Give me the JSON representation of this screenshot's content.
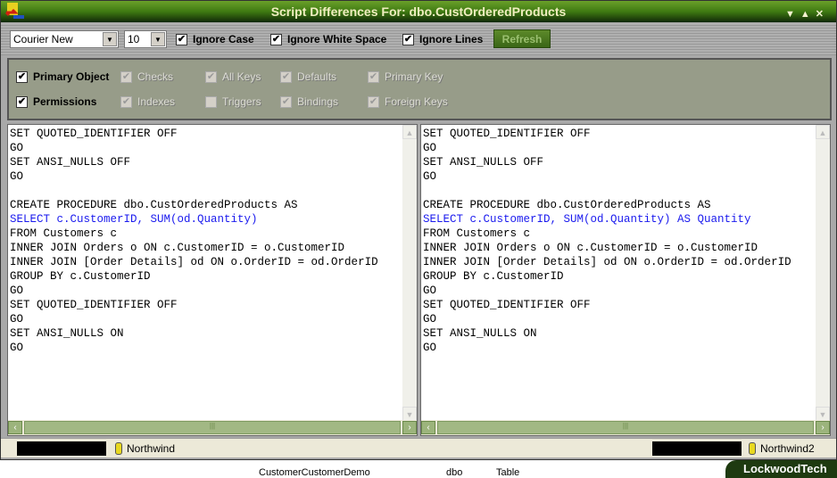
{
  "title": "Script Differences For:  dbo.CustOrderedProducts",
  "toolbar": {
    "font": "Courier New",
    "size": "10",
    "ignore_case": "Ignore Case",
    "ignore_ws": "Ignore White Space",
    "ignore_lines": "Ignore Lines",
    "refresh": "Refresh"
  },
  "options": {
    "primary_object": "Primary Object",
    "permissions": "Permissions",
    "checks": "Checks",
    "indexes": "Indexes",
    "all_keys": "All Keys",
    "triggers": "Triggers",
    "defaults": "Defaults",
    "bindings": "Bindings",
    "primary_key": "Primary Key",
    "foreign_keys": "Foreign Keys"
  },
  "left_code": [
    "SET QUOTED_IDENTIFIER OFF",
    "GO",
    "SET ANSI_NULLS OFF",
    "GO",
    "",
    "CREATE PROCEDURE dbo.CustOrderedProducts AS",
    "SELECT c.CustomerID, SUM(od.Quantity)",
    "FROM Customers c",
    "INNER JOIN Orders o ON c.CustomerID = o.CustomerID",
    "INNER JOIN [Order Details] od ON o.OrderID = od.OrderID",
    "GROUP BY c.CustomerID",
    "GO",
    "SET QUOTED_IDENTIFIER OFF",
    "GO",
    "SET ANSI_NULLS ON",
    "GO"
  ],
  "right_code": [
    "SET QUOTED_IDENTIFIER OFF",
    "GO",
    "SET ANSI_NULLS OFF",
    "GO",
    "",
    "CREATE PROCEDURE dbo.CustOrderedProducts AS",
    "SELECT c.CustomerID, SUM(od.Quantity) AS Quantity",
    "FROM Customers c",
    "INNER JOIN Orders o ON c.CustomerID = o.CustomerID",
    "INNER JOIN [Order Details] od ON o.OrderID = od.OrderID",
    "GROUP BY c.CustomerID",
    "GO",
    "SET QUOTED_IDENTIFIER OFF",
    "GO",
    "SET ANSI_NULLS ON",
    "GO"
  ],
  "status": {
    "left_db": "Northwind",
    "right_db": "Northwind2"
  },
  "background": {
    "row_name": "CustomerCustomerDemo",
    "owner": "dbo",
    "type": "Table"
  },
  "brand": "LockwoodTech"
}
